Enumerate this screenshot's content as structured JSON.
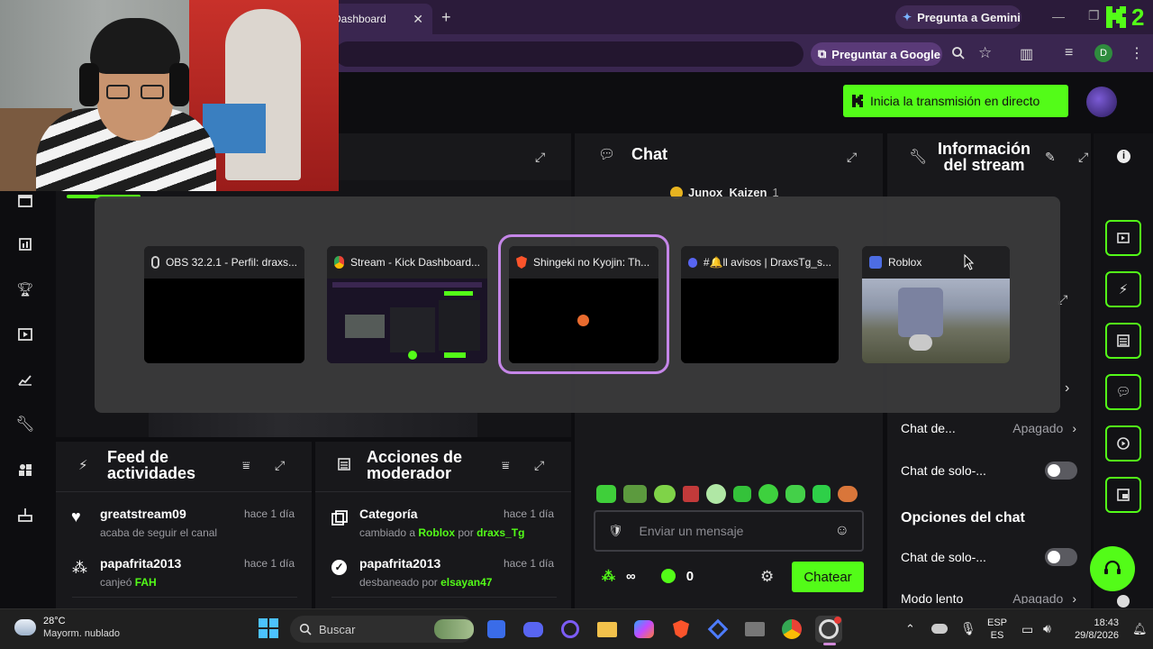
{
  "browser": {
    "active_tab_title": "Dashboard",
    "gemini_button": "Pregunta a Gemini",
    "google_button": "Preguntar a Google",
    "profile_initial": "D",
    "extension_badge": "2"
  },
  "dashboard": {
    "go_live_label": "Inicia la transmisión en directo",
    "chat": {
      "title": "Chat",
      "top_user": "Junox_Kaizen",
      "top_user_count": "1",
      "input_placeholder": "Enviar un mensaje",
      "send_label": "Chatear",
      "viewer_count": "0"
    },
    "stream_info": {
      "title_line1": "Información",
      "title_line2": "del stream",
      "rows": [
        {
          "label": "Chat de...",
          "value": "Apagado"
        },
        {
          "label": "Chat de solo-..."
        }
      ],
      "chat_options_title": "Opciones del chat",
      "chat_options_rows": [
        {
          "label": "Chat de solo-..."
        },
        {
          "label": "Modo lento",
          "value": "Apagado"
        }
      ]
    },
    "activity_feed": {
      "title_line1": "Feed de",
      "title_line2": "actividades",
      "items": [
        {
          "user": "greatstream09",
          "time": "hace 1 día",
          "action": "acaba de seguir el canal"
        },
        {
          "user": "papafrita2013",
          "time": "hace 1 día",
          "action_prefix": "canjeó ",
          "action_highlight": "FAH"
        }
      ]
    },
    "mod_actions": {
      "title_line1": "Acciones de",
      "title_line2": "moderador",
      "items": [
        {
          "title": "Categoría",
          "time": "hace 1 día",
          "prefix": "cambiado a ",
          "hl1": "Roblox",
          "mid": " por ",
          "hl2": "draxs_Tg"
        },
        {
          "title": "papafrita2013",
          "time": "hace 1 día",
          "prefix": "desbaneado por ",
          "hl1": "elsayan47"
        }
      ]
    }
  },
  "switcher": {
    "windows": [
      {
        "title": "OBS 32.2.1 - Perfil: draxs...",
        "icon": "obs-icon",
        "selected": false
      },
      {
        "title": "Stream - Kick Dashboard...",
        "icon": "chrome-icon",
        "selected": false
      },
      {
        "title": "Shingeki no Kyojin: Th...",
        "icon": "brave-icon",
        "selected": true
      },
      {
        "title": "#🔔ll avisos | DraxsTg_s...",
        "icon": "discord-icon",
        "selected": false
      },
      {
        "title": "Roblox",
        "icon": "roblox-icon",
        "selected": false
      }
    ]
  },
  "taskbar": {
    "weather_temp": "28°C",
    "weather_desc": "Mayorm. nublado",
    "search_label": "Buscar",
    "lang_line1": "ESP",
    "lang_line2": "ES",
    "time": "18:43",
    "date": "29/8/2026"
  },
  "colors": {
    "kick_green": "#53fc18",
    "browser_frame": "#2b1b3a",
    "selection_outline": "#c586e8"
  }
}
